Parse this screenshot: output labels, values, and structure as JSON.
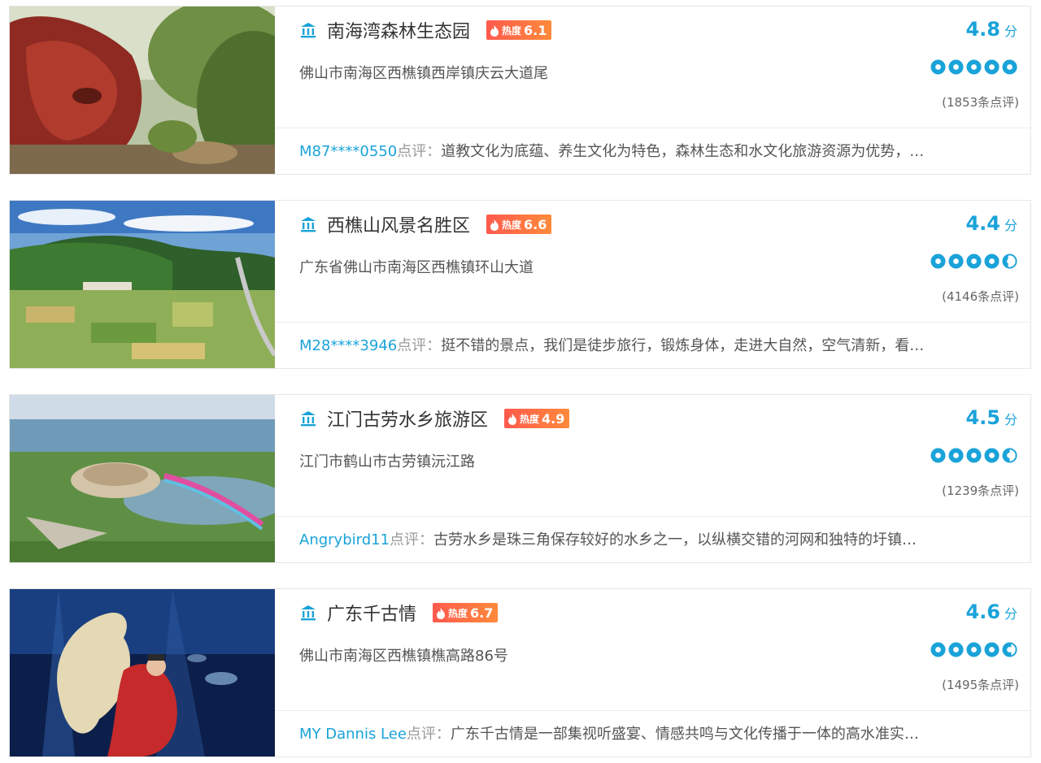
{
  "colors": {
    "accent": "#1aa3d9",
    "heat_start": "#ff5a4e",
    "heat_end": "#ff8a3a",
    "text": "#333333",
    "border": "#e6e6e6"
  },
  "icons": {
    "poi": "museum-pillar-icon",
    "heat": "flame-icon",
    "rating": "circle-rating-icon"
  },
  "attractions": [
    {
      "name": "南海湾森林生态园",
      "heat_label": "热度",
      "heat": "6.1",
      "address": "佛山市南海区西樵镇西岸镇庆云大道尾",
      "score": "4.8",
      "score_unit": "分",
      "rating": 5,
      "reviews": "(1853条点评)",
      "comment_user": "M87****0550",
      "comment_sep": "点评：",
      "comment": "道教文化为底蕴、养生文化为特色，森林生态和水文化旅游资源为优势，…"
    },
    {
      "name": "西樵山风景名胜区",
      "heat_label": "热度",
      "heat": "6.6",
      "address": "广东省佛山市南海区西樵镇环山大道",
      "score": "4.4",
      "score_unit": "分",
      "rating": 4.4,
      "reviews": "(4146条点评)",
      "comment_user": "M28****3946",
      "comment_sep": "点评：",
      "comment": "挺不错的景点，我们是徒步旅行，锻炼身体，走进大自然，空气清新，看…"
    },
    {
      "name": "江门古劳水乡旅游区",
      "heat_label": "热度",
      "heat": "4.9",
      "address": "江门市鹤山市古劳镇沅江路",
      "score": "4.5",
      "score_unit": "分",
      "rating": 4.5,
      "reviews": "(1239条点评)",
      "comment_user": "Angrybird11",
      "comment_sep": "点评：",
      "comment": "古劳水乡是珠三角保存较好的水乡之一，以纵横交错的河网和独特的圩镇…"
    },
    {
      "name": "广东千古情",
      "heat_label": "热度",
      "heat": "6.7",
      "address": "佛山市南海区西樵镇樵高路86号",
      "score": "4.6",
      "score_unit": "分",
      "rating": 4.6,
      "reviews": "(1495条点评)",
      "comment_user": "MY Dannis Lee",
      "comment_sep": "点评：",
      "comment": "广东千古情是一部集视听盛宴、情感共鸣与文化传播于一体的高水准实…"
    }
  ]
}
